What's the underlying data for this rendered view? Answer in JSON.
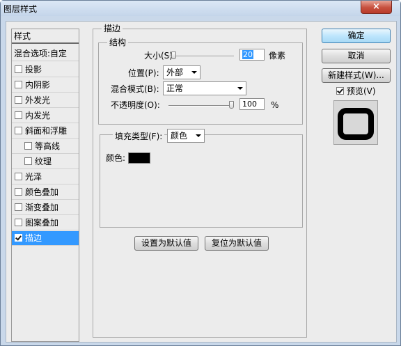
{
  "window": {
    "title": "图层样式",
    "close_glyph": "×"
  },
  "style_list": {
    "header": "样式",
    "blend_options": "混合选项:自定",
    "items": [
      {
        "label": "投影",
        "checked": false,
        "indent": false,
        "selected": false
      },
      {
        "label": "内阴影",
        "checked": false,
        "indent": false,
        "selected": false
      },
      {
        "label": "外发光",
        "checked": false,
        "indent": false,
        "selected": false
      },
      {
        "label": "内发光",
        "checked": false,
        "indent": false,
        "selected": false
      },
      {
        "label": "斜面和浮雕",
        "checked": false,
        "indent": false,
        "selected": false
      },
      {
        "label": "等高线",
        "checked": false,
        "indent": true,
        "selected": false
      },
      {
        "label": "纹理",
        "checked": false,
        "indent": true,
        "selected": false
      },
      {
        "label": "光泽",
        "checked": false,
        "indent": false,
        "selected": false
      },
      {
        "label": "颜色叠加",
        "checked": false,
        "indent": false,
        "selected": false
      },
      {
        "label": "渐变叠加",
        "checked": false,
        "indent": false,
        "selected": false
      },
      {
        "label": "图案叠加",
        "checked": false,
        "indent": false,
        "selected": false
      },
      {
        "label": "描边",
        "checked": true,
        "indent": false,
        "selected": true
      }
    ]
  },
  "stroke": {
    "group_title": "描边",
    "structure": {
      "group_title": "结构",
      "size_label": "大小(S):",
      "size_value": "20",
      "size_unit": "像素",
      "size_slider_fraction": 0.07,
      "position_label": "位置(P):",
      "position_value": "外部",
      "blend_label": "混合模式(B):",
      "blend_value": "正常",
      "opacity_label": "不透明度(O):",
      "opacity_value": "100",
      "opacity_unit": "%",
      "opacity_slider_fraction": 1.0
    },
    "fill": {
      "type_label": "填充类型(F):",
      "type_value": "颜色",
      "color_label": "颜色:",
      "color_hex": "#000000"
    },
    "set_default_button": "设置为默认值",
    "reset_default_button": "复位为默认值"
  },
  "actions": {
    "ok_button": "确定",
    "cancel_button": "取消",
    "new_style_button": "新建样式(W)...",
    "preview_label": "预览(V)",
    "preview_checked": true
  }
}
